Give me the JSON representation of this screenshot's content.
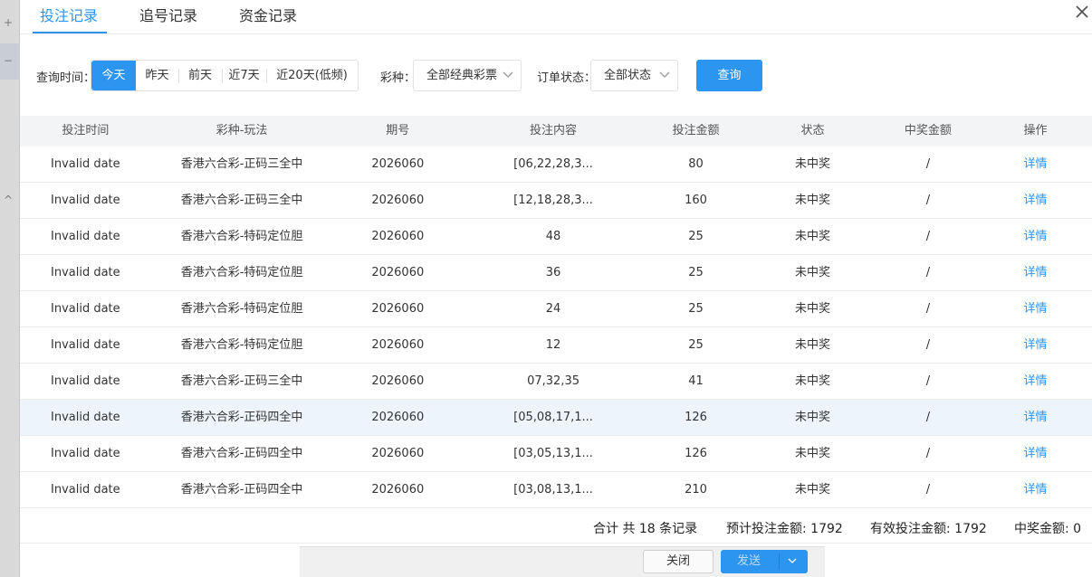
{
  "tabs": [
    {
      "label": "投注记录",
      "active": true
    },
    {
      "label": "追号记录",
      "active": false
    },
    {
      "label": "资金记录",
      "active": false
    }
  ],
  "filters": {
    "time_label": "查询时间：",
    "time_options": [
      "今天",
      "昨天",
      "前天",
      "近7天",
      "近20天(低频)"
    ],
    "time_selected": "今天",
    "lottery_label": "彩种：",
    "lottery_value": "全部经典彩票",
    "status_label": "订单状态：",
    "status_value": "全部状态",
    "query_button": "查询"
  },
  "table": {
    "columns": [
      "投注时间",
      "彩种-玩法",
      "期号",
      "投注内容",
      "投注金额",
      "状态",
      "中奖金额",
      "操作"
    ],
    "rows": [
      [
        "Invalid date",
        "香港六合彩-正码三全中",
        "2026060",
        "[06,22,28,3...",
        "80",
        "未中奖",
        "/",
        "详情"
      ],
      [
        "Invalid date",
        "香港六合彩-正码三全中",
        "2026060",
        "[12,18,28,3...",
        "160",
        "未中奖",
        "/",
        "详情"
      ],
      [
        "Invalid date",
        "香港六合彩-特码定位胆",
        "2026060",
        "48",
        "25",
        "未中奖",
        "/",
        "详情"
      ],
      [
        "Invalid date",
        "香港六合彩-特码定位胆",
        "2026060",
        "36",
        "25",
        "未中奖",
        "/",
        "详情"
      ],
      [
        "Invalid date",
        "香港六合彩-特码定位胆",
        "2026060",
        "24",
        "25",
        "未中奖",
        "/",
        "详情"
      ],
      [
        "Invalid date",
        "香港六合彩-特码定位胆",
        "2026060",
        "12",
        "25",
        "未中奖",
        "/",
        "详情"
      ],
      [
        "Invalid date",
        "香港六合彩-正码三全中",
        "2026060",
        "07,32,35",
        "41",
        "未中奖",
        "/",
        "详情"
      ],
      [
        "Invalid date",
        "香港六合彩-正码四全中",
        "2026060",
        "[05,08,17,1...",
        "126",
        "未中奖",
        "/",
        "详情"
      ],
      [
        "Invalid date",
        "香港六合彩-正码四全中",
        "2026060",
        "[03,05,13,1...",
        "126",
        "未中奖",
        "/",
        "详情"
      ],
      [
        "Invalid date",
        "香港六合彩-正码四全中",
        "2026060",
        "[03,08,13,1...",
        "210",
        "未中奖",
        "/",
        "详情"
      ]
    ],
    "highlighted_row": 7
  },
  "summary": {
    "total": "合计 共 18 条记录",
    "expected_bet": "预计投注金额: 1792",
    "valid_bet": "有效投注金额: 1792",
    "win_amount": "中奖金额: 0"
  },
  "footer": {
    "close_label": "关闭",
    "send_label": "发送"
  },
  "colors": {
    "accent": "#2b95f0",
    "header_bg": "#f3f4f6",
    "row_highlight": "#eef4fc"
  }
}
